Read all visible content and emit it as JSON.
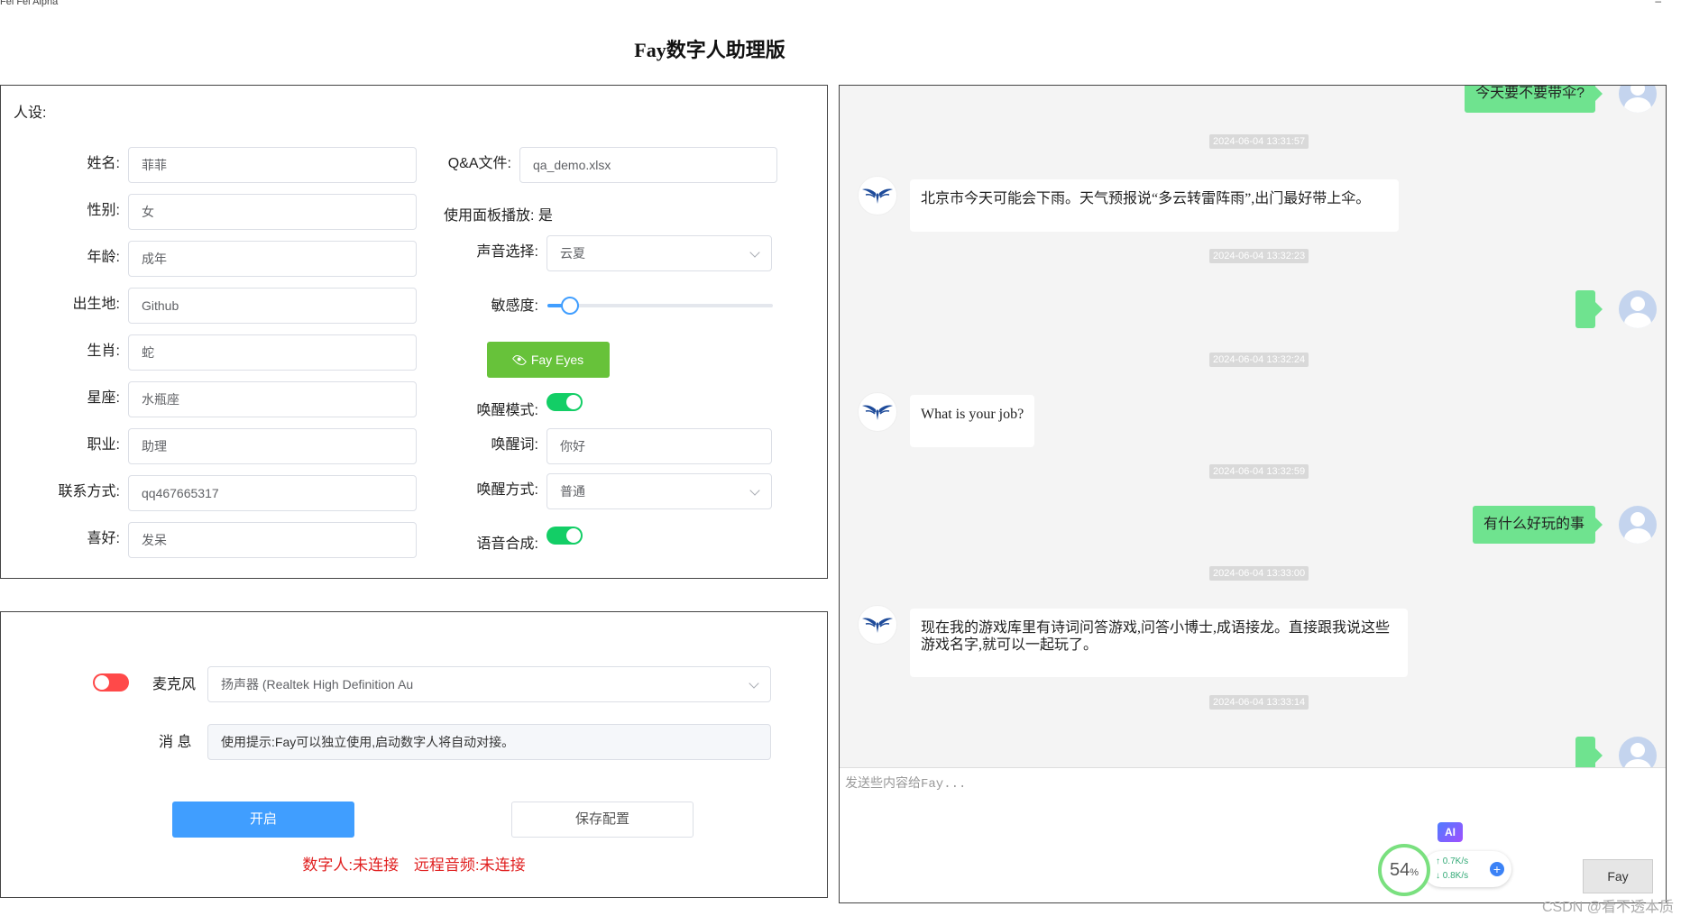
{
  "window": {
    "title": "Fei Fei Alpha",
    "corner_glyph": "–"
  },
  "page_title": "Fay数字人助理版",
  "persona": {
    "section_label": "人设:",
    "fields": [
      {
        "label": "姓名:",
        "value": "菲菲"
      },
      {
        "label": "性别:",
        "value": "女"
      },
      {
        "label": "年龄:",
        "value": "成年"
      },
      {
        "label": "出生地:",
        "value": "Github"
      },
      {
        "label": "生肖:",
        "value": "蛇"
      },
      {
        "label": "星座:",
        "value": "水瓶座"
      },
      {
        "label": "职业:",
        "value": "助理"
      },
      {
        "label": "联系方式:",
        "value": "qq467665317"
      },
      {
        "label": "喜好:",
        "value": "发呆"
      }
    ],
    "qa_file": {
      "label": "Q&A文件:",
      "value": "qa_demo.xlsx"
    },
    "panel_play": "使用面板播放: 是",
    "voice": {
      "label": "声音选择:",
      "value": "云夏"
    },
    "sensitivity": {
      "label": "敏感度:",
      "value_percent": 10
    },
    "fay_eyes_label": "Fay Eyes",
    "wake_mode": {
      "label": "唤醒模式:",
      "on": true
    },
    "wake_word": {
      "label": "唤醒词:",
      "value": "你好"
    },
    "wake_method": {
      "label": "唤醒方式:",
      "value": "普通"
    },
    "tts": {
      "label": "语音合成:",
      "on": true
    }
  },
  "control": {
    "mic_label": "麦克风",
    "mic_on": false,
    "mic_device": "扬声器 (Realtek High Definition Au",
    "message_label": "消 息",
    "message_text": "使用提示:Fay可以独立使用,启动数字人将自动对接。",
    "start_label": "开启",
    "save_label": "保存配置",
    "status_digital": "数字人:未连接",
    "status_remote": "远程音频:未连接"
  },
  "chat": {
    "user_1": "今天要不要带伞?",
    "ts_1": "2024-06-04 13:31:57",
    "bot_1": "北京市今天可能会下雨。天气预报说“多云转雷阵雨”,出门最好带上伞。",
    "ts_2": "2024-06-04 13:32:23",
    "ts_3": "2024-06-04 13:32:24",
    "bot_2": "What is your job?",
    "ts_4": "2024-06-04 13:32:59",
    "user_3": "有什么好玩的事",
    "ts_5": "2024-06-04 13:33:00",
    "bot_3": "现在我的游戏库里有诗词问答游戏,问答小博士,成语接龙。直接跟我说这些游戏名字,就可以一起玩了。",
    "ts_6": "2024-06-04 13:33:14",
    "input_placeholder": "发送些内容给Fay...",
    "send_label": "Fay"
  },
  "overlay": {
    "ai_badge": "AI",
    "cpu_value": "54",
    "cpu_unit": "%",
    "up_speed": "↑ 0.7K/s",
    "down_speed": "↓ 0.8K/s",
    "plus": "+"
  },
  "watermark": "CSDN @看不透本质",
  "colors": {
    "accent_blue": "#409eff",
    "switch_on": "#13ce66",
    "switch_off": "#ff4949",
    "fay_eyes_green": "#67c23a",
    "user_bubble": "#6fe38f",
    "status_red": "#e02020"
  }
}
